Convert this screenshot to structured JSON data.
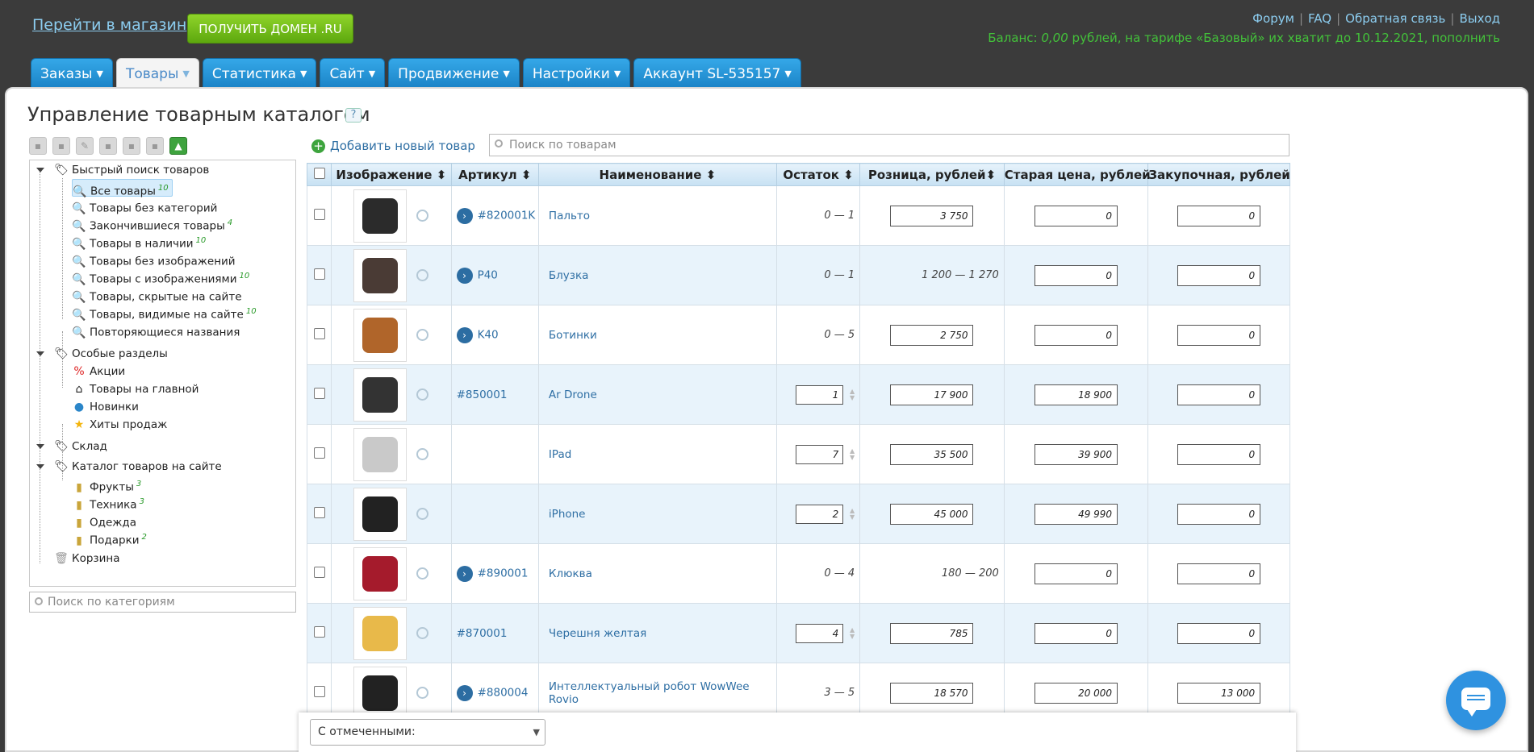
{
  "header": {
    "shop_link": "Перейти в магазин",
    "domain_button": "ПОЛУЧИТЬ ДОМЕН .RU",
    "links": [
      "Форум",
      "FAQ",
      "Обратная связь",
      "Выход"
    ],
    "balance_prefix": "Баланс: ",
    "balance_amount": "0,00",
    "balance_suffix": " рублей, на тарифе «Базовый» их хватит до 10.12.2021, пополнить"
  },
  "tabs": [
    {
      "label": "Заказы",
      "active": false
    },
    {
      "label": "Товары",
      "active": true
    },
    {
      "label": "Статистика",
      "active": false
    },
    {
      "label": "Сайт",
      "active": false
    },
    {
      "label": "Продвижение",
      "active": false
    },
    {
      "label": "Настройки",
      "active": false
    },
    {
      "label": "Аккаунт SL-535157",
      "active": false
    }
  ],
  "page": {
    "title": "Управление товарным каталогом",
    "help": "?",
    "add_product": "Добавить новый товар",
    "product_search_placeholder": "Поиск по товарам",
    "category_search_placeholder": "Поиск по категориям"
  },
  "tree": {
    "quick": {
      "label": "Быстрый поиск товаров",
      "items": [
        {
          "label": "Все товары",
          "count": "10"
        },
        {
          "label": "Товары без категорий",
          "count": ""
        },
        {
          "label": "Закончившиеся товары",
          "count": "4"
        },
        {
          "label": "Товары в наличии",
          "count": "10"
        },
        {
          "label": "Товары без изображений",
          "count": ""
        },
        {
          "label": "Товары с изображениями",
          "count": "10"
        },
        {
          "label": "Товары, скрытые на сайте",
          "count": ""
        },
        {
          "label": "Товары, видимые на сайте",
          "count": "10"
        },
        {
          "label": "Повторяющиеся названия",
          "count": ""
        }
      ]
    },
    "special": {
      "label": "Особые разделы",
      "items": [
        {
          "label": "Акции",
          "icon": "percent-icon"
        },
        {
          "label": "Товары на главной",
          "icon": "home-icon"
        },
        {
          "label": "Новинки",
          "icon": "new-icon"
        },
        {
          "label": "Хиты продаж",
          "icon": "star-icon"
        }
      ]
    },
    "warehouse": "Склад",
    "catalog": {
      "label": "Каталог товаров на сайте",
      "items": [
        {
          "label": "Фрукты",
          "count": "3"
        },
        {
          "label": "Техника",
          "count": "3"
        },
        {
          "label": "Одежда",
          "count": ""
        },
        {
          "label": "Подарки",
          "count": "2"
        }
      ]
    },
    "trash": "Корзина"
  },
  "table": {
    "columns": [
      "Изображение",
      "Артикул",
      "Наименование",
      "Остаток",
      "Розница, рублей",
      "Старая цена, рублей",
      "Закупочная, рублей"
    ],
    "rows": [
      {
        "sku": "#820001K",
        "name": "Пальто",
        "stock": "0 — 1",
        "stock_input": false,
        "retail": "3 750",
        "retail_input": true,
        "old": "0",
        "purchase": "0",
        "arrow": true
      },
      {
        "sku": "P40",
        "name": "Блузка",
        "stock": "0 — 1",
        "stock_input": false,
        "retail": "1 200 — 1 270",
        "retail_input": false,
        "old": "0",
        "purchase": "0",
        "arrow": true
      },
      {
        "sku": "K40",
        "name": "Ботинки",
        "stock": "0 — 5",
        "stock_input": false,
        "retail": "2 750",
        "retail_input": true,
        "old": "0",
        "purchase": "0",
        "arrow": true
      },
      {
        "sku": "#850001",
        "name": "Ar Drone",
        "stock": "1",
        "stock_input": true,
        "retail": "17 900",
        "retail_input": true,
        "old": "18 900",
        "purchase": "0",
        "arrow": false
      },
      {
        "sku": "",
        "name": "IPad",
        "stock": "7",
        "stock_input": true,
        "retail": "35 500",
        "retail_input": true,
        "old": "39 900",
        "purchase": "0",
        "arrow": false
      },
      {
        "sku": "",
        "name": "iPhone",
        "stock": "2",
        "stock_input": true,
        "retail": "45 000",
        "retail_input": true,
        "old": "49 990",
        "purchase": "0",
        "arrow": false
      },
      {
        "sku": "#890001",
        "name": "Клюква",
        "stock": "0 — 4",
        "stock_input": false,
        "retail": "180 — 200",
        "retail_input": false,
        "old": "0",
        "purchase": "0",
        "arrow": true
      },
      {
        "sku": "#870001",
        "name": "Черешня желтая",
        "stock": "4",
        "stock_input": true,
        "retail": "785",
        "retail_input": true,
        "old": "0",
        "purchase": "0",
        "arrow": false
      },
      {
        "sku": "#880004",
        "name": "Интеллектуальный робот WowWee Rovio",
        "stock": "3 — 5",
        "stock_input": false,
        "retail": "18 570",
        "retail_input": true,
        "old": "20 000",
        "purchase": "13 000",
        "arrow": true
      }
    ]
  },
  "bulk": {
    "select_label": "С отмеченными:"
  },
  "colors": {
    "accent": "#1a82c6",
    "green": "#43c13a",
    "link": "#2f6fa4"
  }
}
